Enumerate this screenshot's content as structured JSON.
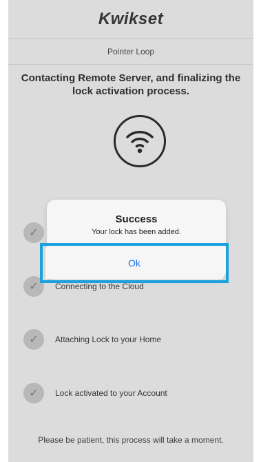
{
  "header": {
    "logo": "Kwikset"
  },
  "subheader": {
    "title": "Pointer Loop"
  },
  "headline": "Contacting Remote Server, and finalizing the lock activation process.",
  "steps": [
    {
      "label": "",
      "icon": "check-icon"
    },
    {
      "label": "Connecting to the Cloud",
      "icon": "check-icon"
    },
    {
      "label": "Attaching Lock to your Home",
      "icon": "check-icon"
    },
    {
      "label": "Lock activated to your Account",
      "icon": "check-icon"
    }
  ],
  "footer": "Please be patient, this process will take a moment.",
  "alert": {
    "title": "Success",
    "message": "Your lock has been added.",
    "ok_label": "Ok"
  },
  "colors": {
    "highlight": "#1ba2dc",
    "ok_text": "#1a73e8",
    "background": "#efefef"
  }
}
